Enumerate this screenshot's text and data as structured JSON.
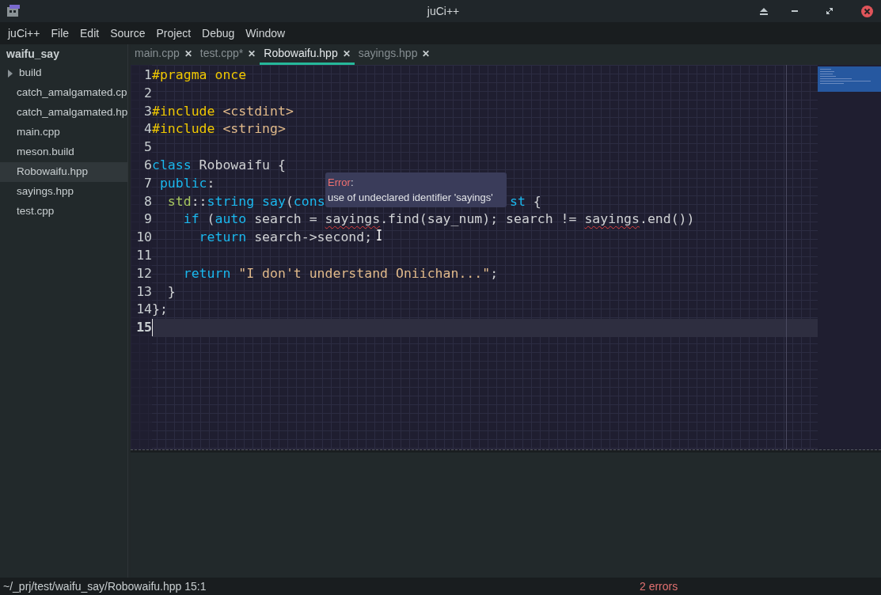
{
  "window": {
    "title": "juCi++"
  },
  "menu": [
    "juCi++",
    "File",
    "Edit",
    "Source",
    "Project",
    "Debug",
    "Window"
  ],
  "sidebar": {
    "title": "waifu_say",
    "items": [
      {
        "label": "build",
        "kind": "folder",
        "expanded": false,
        "selected": false
      },
      {
        "label": "catch_amalgamated.cp",
        "kind": "file",
        "selected": false
      },
      {
        "label": "catch_amalgamated.hp",
        "kind": "file",
        "selected": false
      },
      {
        "label": "main.cpp",
        "kind": "file",
        "selected": false
      },
      {
        "label": "meson.build",
        "kind": "file",
        "selected": false
      },
      {
        "label": "Robowaifu.hpp",
        "kind": "file",
        "selected": true
      },
      {
        "label": "sayings.hpp",
        "kind": "file",
        "selected": false
      },
      {
        "label": "test.cpp",
        "kind": "file",
        "selected": false
      }
    ]
  },
  "tabs": [
    {
      "label": "main.cpp",
      "selected": false,
      "close": "✕"
    },
    {
      "label": "test.cpp*",
      "selected": false,
      "close": "✕"
    },
    {
      "label": "Robowaifu.hpp",
      "selected": true,
      "close": "✕"
    },
    {
      "label": "sayings.hpp",
      "selected": false,
      "close": "✕"
    }
  ],
  "editor": {
    "lines": [
      {
        "number": "1",
        "tokens": [
          {
            "t": "#pragma once",
            "kind": "pre"
          }
        ]
      },
      {
        "number": "2"
      },
      {
        "number": "3",
        "tokens": [
          {
            "t": "#include ",
            "kind": "pre"
          },
          {
            "t": "<cstdint>",
            "kind": "str"
          }
        ]
      },
      {
        "number": "4",
        "tokens": [
          {
            "t": "#include ",
            "kind": "pre"
          },
          {
            "t": "<string>",
            "kind": "str"
          }
        ]
      },
      {
        "number": "5"
      },
      {
        "number": "6",
        "tokens": [
          {
            "t": "class",
            "kind": "kw"
          },
          {
            "t": " Robowaifu {",
            "kind": "plain"
          }
        ]
      },
      {
        "number": "7",
        "tokens": [
          {
            "t": " public",
            "kind": "kw"
          },
          {
            "t": ":",
            "kind": "plain"
          }
        ]
      },
      {
        "number": "8",
        "tokens": [
          {
            "t": "  std",
            "kind": "type"
          },
          {
            "t": "::",
            "kind": "plain"
          },
          {
            "t": "string",
            "kind": "kw"
          },
          {
            "t": " say",
            "kind": "kw"
          },
          {
            "t": "(",
            "kind": "plain"
          },
          {
            "t": "cons",
            "kind": "kw"
          }
        ],
        "after": [
          {
            "t": "st",
            "kind": "kw"
          },
          {
            "t": " {",
            "kind": "plain"
          }
        ]
      },
      {
        "number": "9",
        "tokens": [
          {
            "t": "    if",
            "kind": "kw"
          },
          {
            "t": " (",
            "kind": "plain"
          },
          {
            "t": "auto",
            "kind": "kw"
          },
          {
            "t": " search = ",
            "kind": "plain"
          },
          {
            "t": "sayings",
            "kind": "error"
          },
          {
            "t": ".find(say_num); search != ",
            "kind": "plain"
          },
          {
            "t": "sayings",
            "kind": "error"
          },
          {
            "t": ".end())",
            "kind": "plain"
          }
        ]
      },
      {
        "number": "10",
        "tokens": [
          {
            "t": "      return",
            "kind": "kw"
          },
          {
            "t": " search->second;",
            "kind": "plain"
          }
        ]
      },
      {
        "number": "11"
      },
      {
        "number": "12",
        "tokens": [
          {
            "t": "    return",
            "kind": "kw"
          },
          {
            "t": " \"I don't understand Oniichan...\"",
            "kind": "str"
          },
          {
            "t": ";",
            "kind": "plain"
          }
        ]
      },
      {
        "number": "13",
        "tokens": [
          {
            "t": "  }",
            "kind": "plain"
          }
        ]
      },
      {
        "number": "14",
        "tokens": [
          {
            "t": "};",
            "kind": "plain"
          }
        ]
      },
      {
        "number": "15",
        "current": true
      }
    ]
  },
  "tooltip": {
    "label": "Error",
    "colon": ":",
    "message": "use of undeclared identifier 'sayings'"
  },
  "status_bar": {
    "path": "~/_prj/test/waifu_say/Robowaifu.hpp 15:1",
    "errors": "2 errors"
  }
}
